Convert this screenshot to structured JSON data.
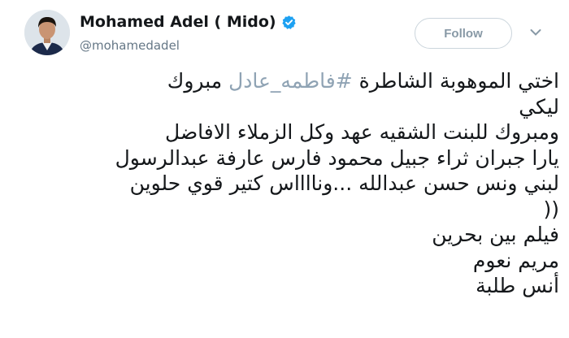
{
  "profile": {
    "display_name": "Mohamed Adel ( Mido)",
    "handle": "@mohamedadel",
    "verified_icon": "verified-badge-icon",
    "verified_color": "#1da1f2"
  },
  "follow_button": {
    "label": "Follow"
  },
  "menu_icon": "chevron-down-icon",
  "tweet": {
    "line1_before": "اختي  الموهوبة الشاطرة ",
    "hashtag": "#فاطمه_عادل",
    "line1_after": " مبروك",
    "lines": [
      "ليكي",
      "ومبروك للبنت الشقيه عهد وكل الزملاء الافاضل",
      "يارا جبران ثراء جبيل محمود فارس عارفة عبدالرسول",
      "لبني ونس حسن عبدالله ...ونااااس كتير قوي حلوين",
      "((",
      "فيلم بين بحرين",
      "مريم نعوم",
      "أنس طلبة"
    ]
  },
  "colors": {
    "text": "#14171a",
    "secondary": "#657786",
    "hashtag": "#8fa3b4",
    "follow_border": "#cbd5dc"
  }
}
